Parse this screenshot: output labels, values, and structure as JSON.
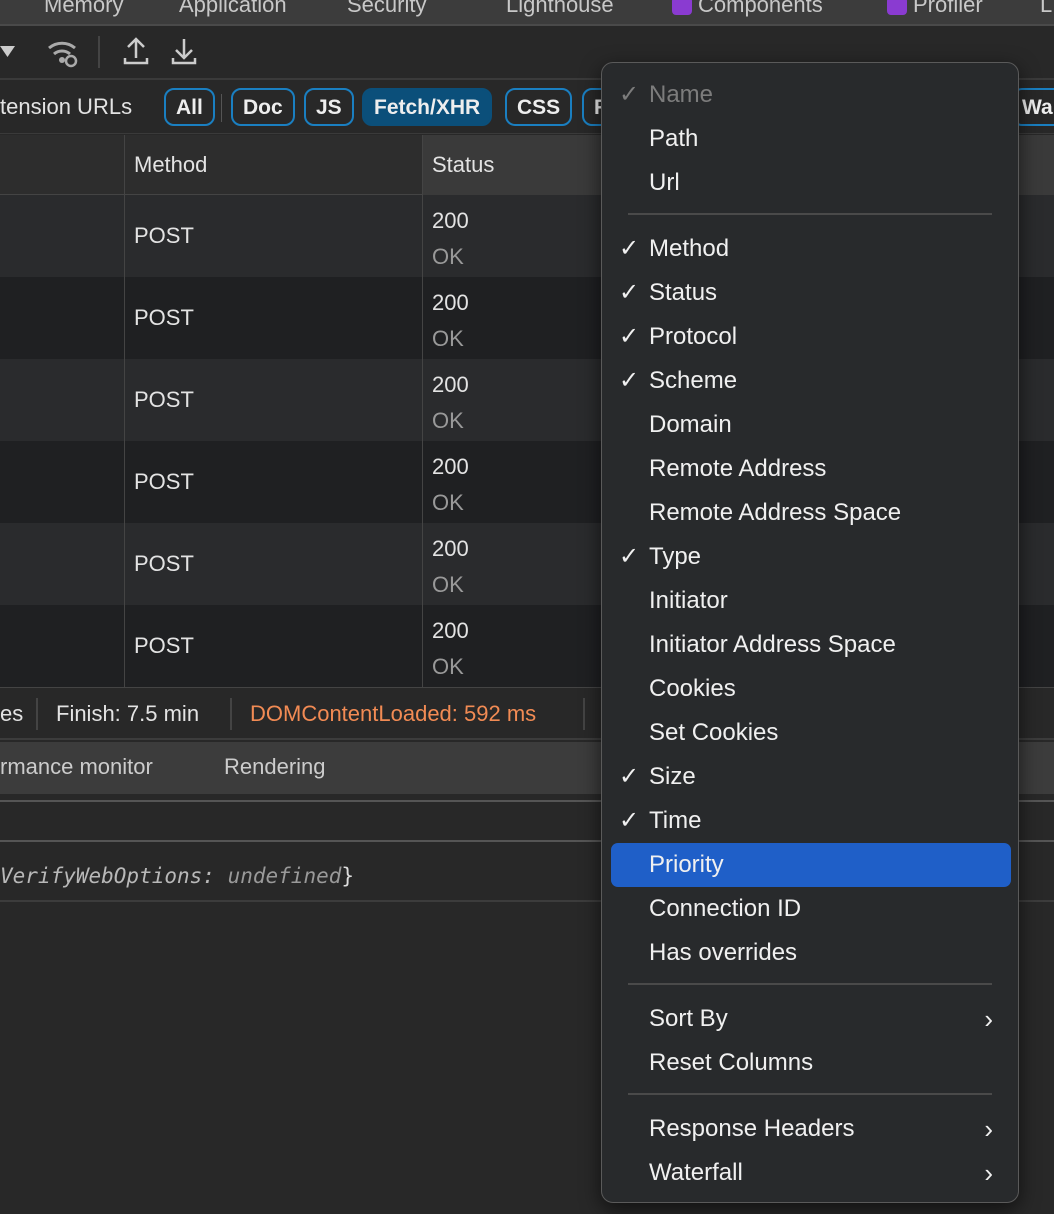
{
  "top_tabs": [
    "Memory",
    "Application",
    "Security",
    "Lighthouse",
    "Components",
    "Profiler",
    "L"
  ],
  "filters": {
    "label": "tension URLs",
    "chips": [
      "All",
      "Doc",
      "JS",
      "Fetch/XHR",
      "CSS",
      "F"
    ],
    "right_chip": "Wa"
  },
  "table": {
    "headers": [
      "Method",
      "Status"
    ],
    "rows": [
      {
        "method": "POST",
        "status": "200",
        "text": "OK"
      },
      {
        "method": "POST",
        "status": "200",
        "text": "OK"
      },
      {
        "method": "POST",
        "status": "200",
        "text": "OK"
      },
      {
        "method": "POST",
        "status": "200",
        "text": "OK"
      },
      {
        "method": "POST",
        "status": "200",
        "text": "OK"
      },
      {
        "method": "POST",
        "status": "200",
        "text": "OK"
      }
    ]
  },
  "status_bar": {
    "partial": "es",
    "finish": "Finish: 7.5 min",
    "dcl": "DOMContentLoaded: 592 ms",
    "dcl_color": "#f28b54"
  },
  "drawer_tabs": [
    "rmance monitor",
    "Rendering"
  ],
  "console": {
    "key": "VerifyWebOptions:",
    "value": "undefined",
    "close": "}"
  },
  "menu": {
    "groups": [
      [
        {
          "label": "Name",
          "checked": true,
          "disabled": true
        },
        {
          "label": "Path",
          "checked": false
        },
        {
          "label": "Url",
          "checked": false
        }
      ],
      [
        {
          "label": "Method",
          "checked": true
        },
        {
          "label": "Status",
          "checked": true
        },
        {
          "label": "Protocol",
          "checked": true
        },
        {
          "label": "Scheme",
          "checked": true
        },
        {
          "label": "Domain",
          "checked": false
        },
        {
          "label": "Remote Address",
          "checked": false
        },
        {
          "label": "Remote Address Space",
          "checked": false
        },
        {
          "label": "Type",
          "checked": true
        },
        {
          "label": "Initiator",
          "checked": false
        },
        {
          "label": "Initiator Address Space",
          "checked": false
        },
        {
          "label": "Cookies",
          "checked": false
        },
        {
          "label": "Set Cookies",
          "checked": false
        },
        {
          "label": "Size",
          "checked": true
        },
        {
          "label": "Time",
          "checked": true
        },
        {
          "label": "Priority",
          "checked": false,
          "highlighted": true
        },
        {
          "label": "Connection ID",
          "checked": false
        },
        {
          "label": "Has overrides",
          "checked": false
        }
      ],
      [
        {
          "label": "Sort By",
          "submenu": true
        },
        {
          "label": "Reset Columns"
        }
      ],
      [
        {
          "label": "Response Headers",
          "submenu": true
        },
        {
          "label": "Waterfall",
          "submenu": true
        }
      ]
    ],
    "check_glyph": "✓",
    "submenu_glyph": "›",
    "highlight_color": "#1f5fc8"
  }
}
